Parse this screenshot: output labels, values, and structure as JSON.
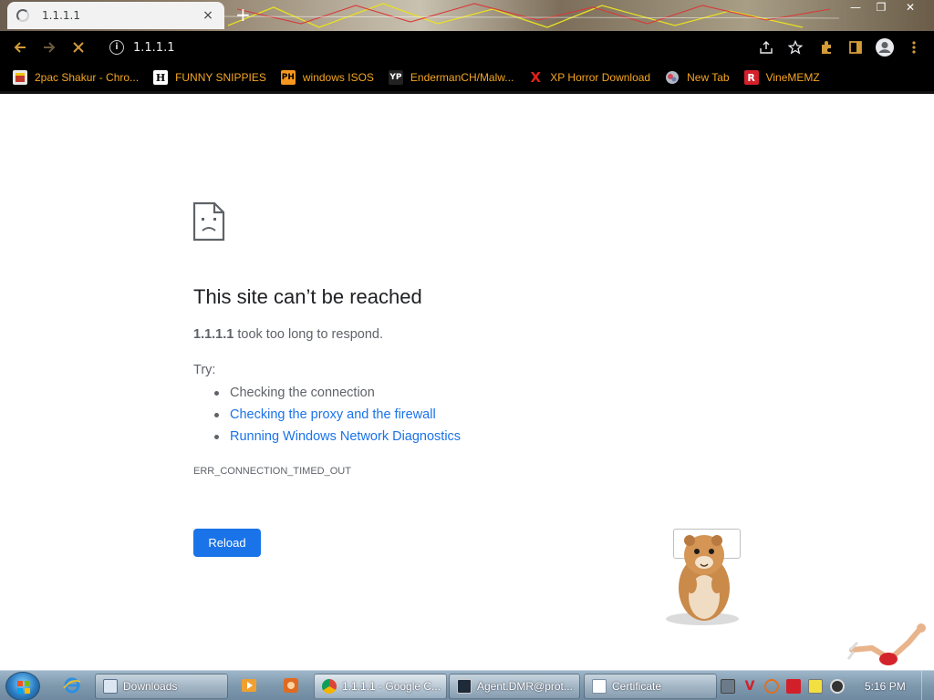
{
  "browser": {
    "tab_title": "1.1.1.1",
    "tab_close": "×",
    "new_tab": "+",
    "url": "1.1.1.1",
    "window_controls": {
      "minimize": "—",
      "maximize": "❐",
      "close": "✕"
    }
  },
  "bookmarks": [
    {
      "label": "2pac Shakur - Chro...",
      "icon": "bookmark-icon"
    },
    {
      "label": "FUNNY SNIPPIES",
      "icon": "h-letter-icon"
    },
    {
      "label": "windows ISOS",
      "icon": "ph-logo-icon"
    },
    {
      "label": "EndermanCH/Malw...",
      "icon": "yp-logo-icon"
    },
    {
      "label": "XP Horror Download",
      "icon": "red-x-icon"
    },
    {
      "label": "New Tab",
      "icon": "globe-icon"
    },
    {
      "label": "VineMEMZ",
      "icon": "r-logo-icon"
    }
  ],
  "error_page": {
    "title": "This site can’t be reached",
    "host": "1.1.1.1",
    "desc_rest": " took too long to respond.",
    "try_label": "Try:",
    "suggestions": [
      "Checking the connection",
      "Checking the proxy and the firewall",
      "Running Windows Network Diagnostics"
    ],
    "error_code": "ERR_CONNECTION_TIMED_OUT",
    "reload_label": "Reload"
  },
  "taskbar": {
    "items": [
      {
        "label": "Downloads"
      },
      {
        "label": "1.1.1.1 - Google C..."
      },
      {
        "label": "Agent.DMR@prot..."
      },
      {
        "label": "Certificate"
      }
    ],
    "clock": "5:16 PM"
  },
  "colors": {
    "bookmark_text": "#f5a623",
    "link": "#1a73e8",
    "reload_button": "#1a73e8",
    "toolbar_bg": "#000000"
  }
}
